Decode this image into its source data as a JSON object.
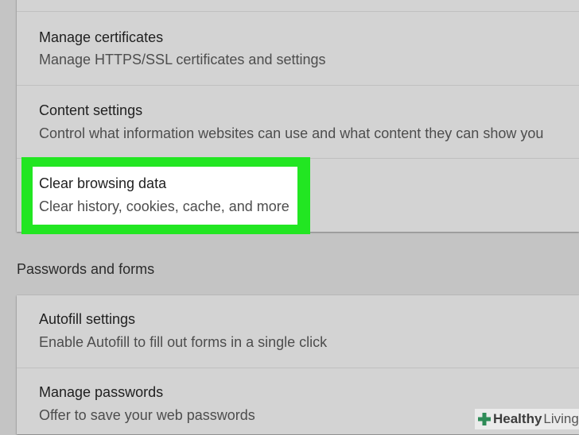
{
  "privacy_rows": [
    {
      "title": "Manage certificates",
      "desc": "Manage HTTPS/SSL certificates and settings"
    },
    {
      "title": "Content settings",
      "desc": "Control what information websites can use and what content they can show you"
    },
    {
      "title": "Clear browsing data",
      "desc": "Clear history, cookies, cache, and more"
    }
  ],
  "passwords_section": {
    "heading": "Passwords and forms",
    "rows": [
      {
        "title": "Autofill settings",
        "desc": "Enable Autofill to fill out forms in a single click"
      },
      {
        "title": "Manage passwords",
        "desc": "Offer to save your web passwords"
      }
    ]
  },
  "watermark": {
    "brand_bold": "Healthy",
    "brand_light": "Living",
    "icon": "plus-cross-icon"
  },
  "colors": {
    "highlight": "#22e622",
    "background": "#c4c4c4",
    "card": "#d3d3d3"
  }
}
